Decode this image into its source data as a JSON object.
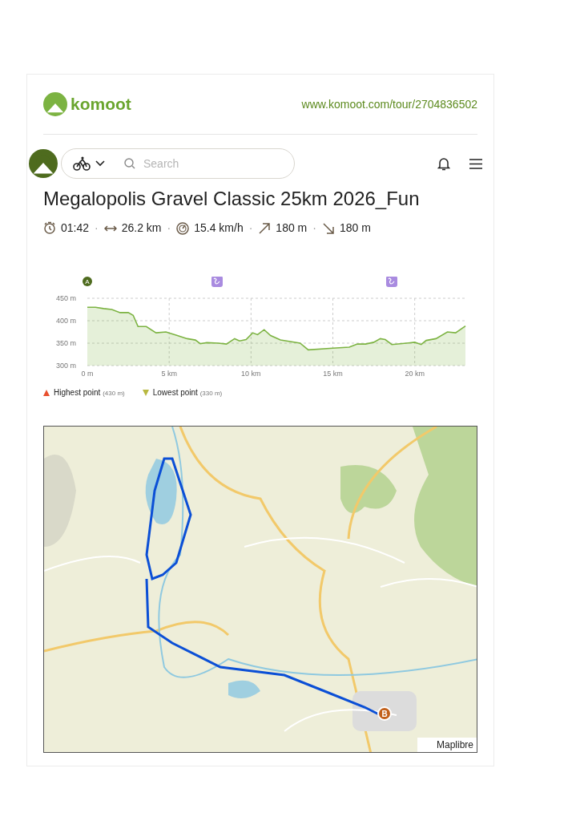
{
  "header": {
    "brand": "komoot",
    "url": "www.komoot.com/tour/2704836502"
  },
  "navbar": {
    "search": {
      "placeholder": "Search"
    }
  },
  "tour": {
    "title": "Megalopolis Gravel Classic 25km 2026_Fun",
    "separator": "·",
    "stats": [
      {
        "kind": "duration",
        "value": "01:42"
      },
      {
        "kind": "distance",
        "value": "26.2 km"
      },
      {
        "kind": "speed",
        "value": "15.4 km/h"
      },
      {
        "kind": "uphill",
        "value": "180 m"
      },
      {
        "kind": "downhill",
        "value": "180 m"
      }
    ]
  },
  "elevation": {
    "start_marker": "A",
    "chart_data": {
      "type": "area",
      "x": [
        0,
        0.5,
        1,
        1.5,
        2,
        2.5,
        2.8,
        3.1,
        3.6,
        4.2,
        4.8,
        5.5,
        6.1,
        6.6,
        6.9,
        7.3,
        8,
        8.5,
        9,
        9.3,
        9.7,
        10.1,
        10.4,
        10.8,
        11.2,
        11.8,
        13,
        13.5,
        15,
        16,
        16.5,
        17,
        17.5,
        17.9,
        18.2,
        18.6,
        19.5,
        20,
        20.4,
        20.7,
        21.3,
        22,
        22.5,
        23.1
      ],
      "grid": true,
      "series": [
        {
          "color": "#7cb342",
          "values": [
            430,
            430,
            427,
            425,
            418,
            418,
            412,
            387,
            387,
            373,
            375,
            367,
            360,
            357,
            349,
            351,
            350,
            348,
            360,
            355,
            358,
            373,
            369,
            380,
            367,
            357,
            350,
            335,
            339,
            341,
            348,
            348,
            352,
            360,
            358,
            347,
            350,
            352,
            347,
            356,
            360,
            375,
            373,
            388
          ]
        }
      ],
      "xlim": [
        0,
        23.1
      ],
      "ylim": [
        300,
        450
      ],
      "xticks": [
        {
          "value": 0,
          "label": "0 m"
        },
        {
          "value": 5,
          "label": "5 km"
        },
        {
          "value": 10,
          "label": "10 km"
        },
        {
          "value": 15,
          "label": "15 km"
        },
        {
          "value": 20,
          "label": "20 km"
        }
      ],
      "yticks": [
        {
          "value": 300,
          "label": "300 m"
        },
        {
          "value": 350,
          "label": "350 m"
        },
        {
          "value": 400,
          "label": "400 m"
        },
        {
          "value": 450,
          "label": "450 m"
        }
      ]
    },
    "legend": [
      {
        "kind": "highest",
        "label": "Highest point",
        "value": "(430 m)"
      },
      {
        "kind": "lowest",
        "label": "Lowest point",
        "value": "(330 m)"
      }
    ]
  },
  "map": {
    "kind": "picture",
    "end_marker": "B",
    "attribution": "Maplibre"
  }
}
